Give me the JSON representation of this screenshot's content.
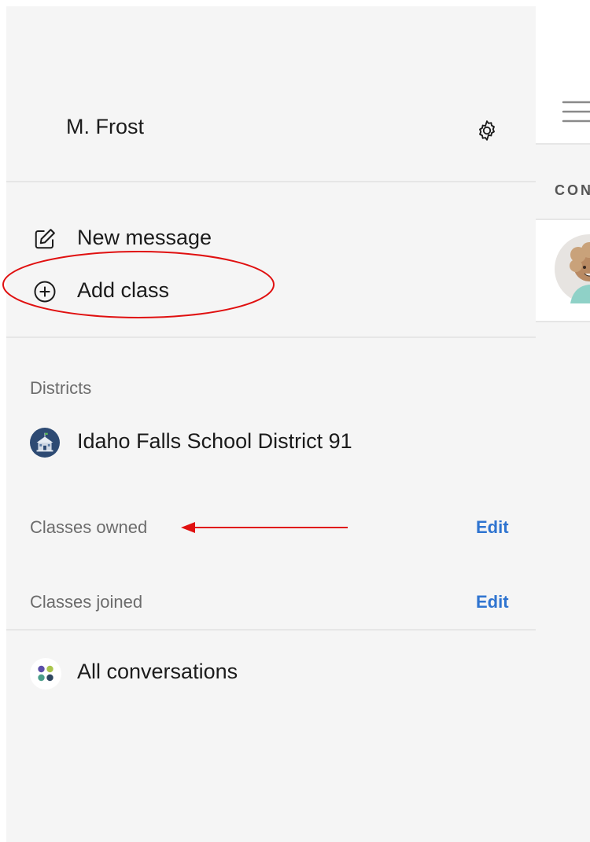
{
  "drawer": {
    "user_name": "M. Frost",
    "actions": [
      {
        "label": "New message",
        "icon": "compose-icon"
      },
      {
        "label": "Add class",
        "icon": "plus-circle-icon"
      }
    ],
    "districts_header": "Districts",
    "districts": [
      {
        "name": "Idaho Falls School District 91",
        "icon": "school-building-icon"
      }
    ],
    "classes_owned": {
      "label": "Classes owned",
      "edit": "Edit"
    },
    "classes_joined": {
      "label": "Classes joined",
      "edit": "Edit"
    },
    "all_conversations": {
      "label": "All conversations",
      "icon": "dots-grid-icon"
    }
  },
  "main": {
    "section_title": "CON",
    "menu_icon": "hamburger-icon"
  },
  "colors": {
    "drawer_bg": "#f5f5f5",
    "link": "#2f74d0",
    "annotation": "#e01010",
    "district_badge": "#2d4a73"
  }
}
